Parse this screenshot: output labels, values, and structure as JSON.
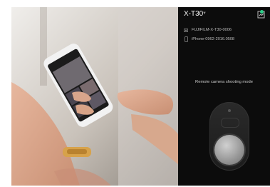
{
  "app": {
    "title": "X-T30",
    "devices": [
      {
        "name": "FUJIFILM-X-T30-0006",
        "icon": "camera-icon"
      },
      {
        "name": "iPhone-0962-2016.0508",
        "icon": "phone-icon"
      }
    ],
    "remote_label": "Remote camera shooting mode"
  },
  "colors": {
    "panel_bg": "#0c0c0c",
    "status_green": "#2ecf8a",
    "text": "#e9e9e9"
  }
}
